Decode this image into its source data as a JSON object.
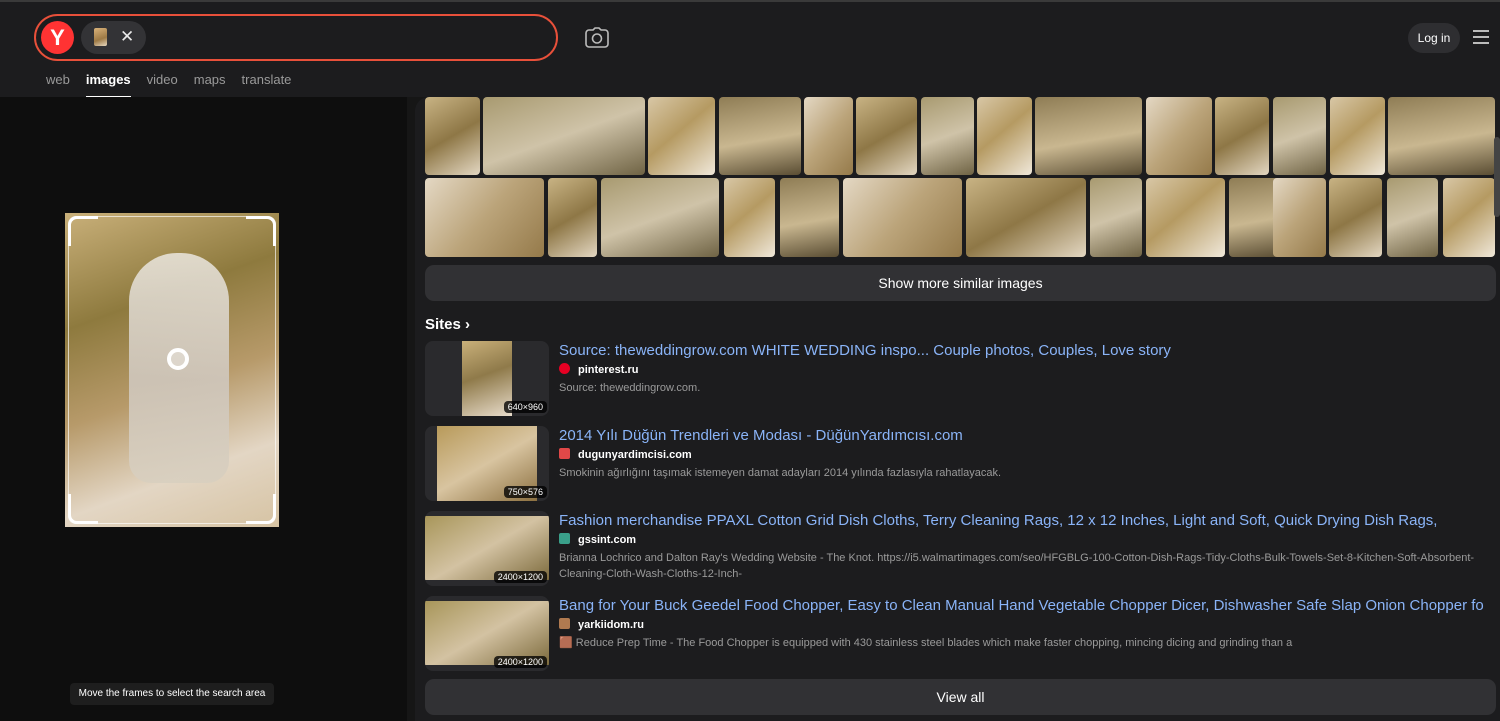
{
  "search": {
    "logo": "Y",
    "chip_close": "✕"
  },
  "header": {
    "login_label": "Log in"
  },
  "nav_tabs": [
    {
      "label": "web",
      "active": false
    },
    {
      "label": "images",
      "active": true
    },
    {
      "label": "video",
      "active": false
    },
    {
      "label": "maps",
      "active": false
    },
    {
      "label": "translate",
      "active": false
    }
  ],
  "left_panel": {
    "hint": "Move the frames to select the search area"
  },
  "similar": {
    "more_label": "Show more similar images"
  },
  "sites_header": {
    "title": "Sites",
    "chevron": "›"
  },
  "sites": [
    {
      "title": "Source: theweddingrow.com WHITE WEDDING inspo... Couple photos, Couples, Love story",
      "domain": "pinterest.ru",
      "favicon_color": "#e60023",
      "desc": "Source: theweddingrow.com.",
      "dims": "640×960"
    },
    {
      "title": "2014 Yılı Düğün Trendleri ve Modası - DüğünYardımcısı.com",
      "domain": "dugunyardimcisi.com",
      "favicon_color": "#e04848",
      "desc": "Smokinin ağırlığını taşımak istemeyen damat adayları 2014 yılında fazlasıyla rahatlayacak.",
      "dims": "750×576"
    },
    {
      "title": "Fashion merchandise PPAXL Cotton Grid Dish Cloths, Terry Cleaning Rags, 12 x 12 Inches, Light and Soft, Quick Drying Dish Rags,",
      "domain": "gssint.com",
      "favicon_color": "#3aa08a",
      "desc": "Brianna Lochrico and Dalton Ray's Wedding Website - The Knot. https://i5.walmartimages.com/seo/HFGBLG-100-Cotton-Dish-Rags-Tidy-Cloths-Bulk-Towels-Set-8-Kitchen-Soft-Absorbent-Cleaning-Cloth-Wash-Cloths-12-Inch-",
      "dims": "2400×1200"
    },
    {
      "title": "Bang for Your Buck Geedel Food Chopper, Easy to Clean Manual Hand Vegetable Chopper Dicer, Dishwasher Safe Slap Onion Chopper fo",
      "domain": "yarkiidom.ru",
      "favicon_color": "#b07a50",
      "desc": "Reduce Prep Time - The Food Chopper is equipped with 430 stainless steel blades which make faster chopping, mincing dicing and grinding than a",
      "dims": "2400×1200"
    }
  ],
  "view_all_label": "View all"
}
